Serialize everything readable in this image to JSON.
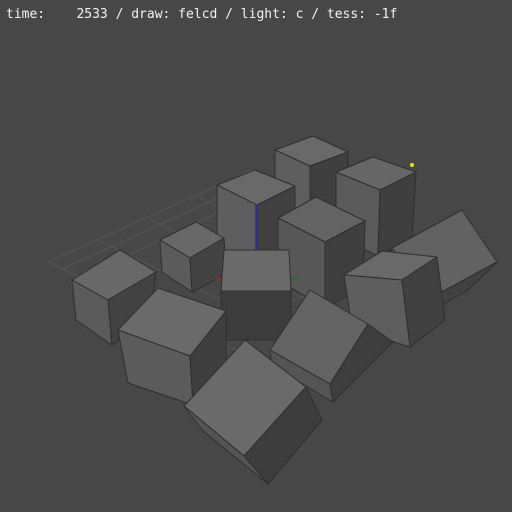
{
  "viewport": {
    "background": "#474747",
    "status_text": "time:    2533 / draw: felcd / light: c / tess: -1f"
  },
  "scene": {
    "cube_count": 12,
    "colors": {
      "face_top": "#696969",
      "face_light": "#5e5e5e",
      "face_dark": "#3f3f3f",
      "grid": "#565656",
      "axis_z": "#3232a0",
      "axis_x": "#8a2a2a",
      "axis_y": "#2a6a2a",
      "light_marker": "#e6e61e"
    }
  }
}
